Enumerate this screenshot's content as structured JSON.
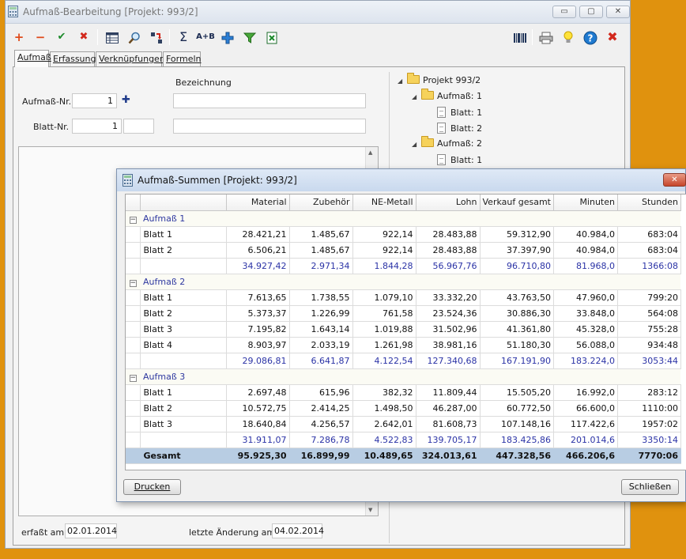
{
  "window": {
    "title": "Aufmaß-Bearbeitung [Projekt: 993/2]",
    "min_label": "▭",
    "max_label": "▢",
    "close_label": "✕"
  },
  "toolbar": {
    "add": "+",
    "remove": "−",
    "confirm": "✔",
    "cancel": "✖",
    "sum": "Σ",
    "ab": "A+B"
  },
  "tabs": [
    {
      "label": "Aufmaß"
    },
    {
      "label": "Erfassung"
    },
    {
      "label": "Verknüpfungen"
    },
    {
      "label": "Formeln"
    }
  ],
  "form": {
    "bezeichnung_label": "Bezeichnung",
    "aufmass_nr_label": "Aufmaß-Nr.",
    "aufmass_nr_value": "1",
    "blatt_nr_label": "Blatt-Nr.",
    "blatt_nr_value": "1",
    "erfasst_label": "erfaßt am:",
    "erfasst_value": "02.01.2014",
    "geaendert_label": "letzte Änderung am:",
    "geaendert_value": "04.02.2014"
  },
  "tree": {
    "root": "Projekt 993/2",
    "nodes": [
      {
        "label": "Aufmaß: 1"
      },
      {
        "label": "Blatt: 1"
      },
      {
        "label": "Blatt: 2"
      },
      {
        "label": "Aufmaß: 2"
      },
      {
        "label": "Blatt: 1"
      }
    ]
  },
  "dialog": {
    "title": "Aufmaß-Summen [Projekt: 993/2]",
    "close_label": "✕",
    "print_label": "Drucken",
    "close_button_label": "Schließen",
    "columns": [
      "Material",
      "Zubehör",
      "NE-Metall",
      "Lohn",
      "Verkauf gesamt",
      "Minuten",
      "Stunden"
    ],
    "groups": [
      {
        "name": "Aufmaß 1",
        "rows": [
          {
            "name": "Blatt 1",
            "values": [
              "28.421,21",
              "1.485,67",
              "922,14",
              "28.483,88",
              "59.312,90",
              "40.984,0",
              "683:04"
            ]
          },
          {
            "name": "Blatt 2",
            "values": [
              "6.506,21",
              "1.485,67",
              "922,14",
              "28.483,88",
              "37.397,90",
              "40.984,0",
              "683:04"
            ]
          }
        ],
        "subtotal": [
          "34.927,42",
          "2.971,34",
          "1.844,28",
          "56.967,76",
          "96.710,80",
          "81.968,0",
          "1366:08"
        ]
      },
      {
        "name": "Aufmaß 2",
        "rows": [
          {
            "name": "Blatt 1",
            "values": [
              "7.613,65",
              "1.738,55",
              "1.079,10",
              "33.332,20",
              "43.763,50",
              "47.960,0",
              "799:20"
            ]
          },
          {
            "name": "Blatt 2",
            "values": [
              "5.373,37",
              "1.226,99",
              "761,58",
              "23.524,36",
              "30.886,30",
              "33.848,0",
              "564:08"
            ]
          },
          {
            "name": "Blatt 3",
            "values": [
              "7.195,82",
              "1.643,14",
              "1.019,88",
              "31.502,96",
              "41.361,80",
              "45.328,0",
              "755:28"
            ]
          },
          {
            "name": "Blatt 4",
            "values": [
              "8.903,97",
              "2.033,19",
              "1.261,98",
              "38.981,16",
              "51.180,30",
              "56.088,0",
              "934:48"
            ]
          }
        ],
        "subtotal": [
          "29.086,81",
          "6.641,87",
          "4.122,54",
          "127.340,68",
          "167.191,90",
          "183.224,0",
          "3053:44"
        ]
      },
      {
        "name": "Aufmaß 3",
        "rows": [
          {
            "name": "Blatt 1",
            "values": [
              "2.697,48",
              "615,96",
              "382,32",
              "11.809,44",
              "15.505,20",
              "16.992,0",
              "283:12"
            ]
          },
          {
            "name": "Blatt 2",
            "values": [
              "10.572,75",
              "2.414,25",
              "1.498,50",
              "46.287,00",
              "60.772,50",
              "66.600,0",
              "1110:00"
            ]
          },
          {
            "name": "Blatt 3",
            "values": [
              "18.640,84",
              "4.256,57",
              "2.642,01",
              "81.608,73",
              "107.148,16",
              "117.422,6",
              "1957:02"
            ]
          }
        ],
        "subtotal": [
          "31.911,07",
          "7.286,78",
          "4.522,83",
          "139.705,17",
          "183.425,86",
          "201.014,6",
          "3350:14"
        ]
      }
    ],
    "total": {
      "label": "Gesamt",
      "values": [
        "95.925,30",
        "16.899,99",
        "10.489,65",
        "324.013,61",
        "447.328,56",
        "466.206,6",
        "7770:06"
      ]
    }
  },
  "colors": {
    "background": "#e0920e",
    "subtotal_text": "#2b33a6",
    "total_row": "#b8cde3",
    "group_title": "#2f39a0"
  }
}
